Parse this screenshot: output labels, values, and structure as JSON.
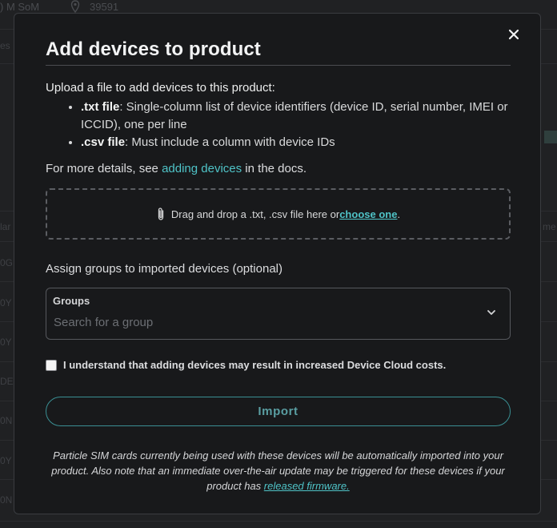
{
  "background": {
    "top_text_1": ") M SoM",
    "top_text_2": "39591",
    "side_fragments": [
      "es",
      "lar",
      "0G",
      "0Y",
      "0Y",
      "DEL",
      "0N",
      "0Y",
      "0N",
      "me"
    ]
  },
  "modal": {
    "title": "Add devices to product",
    "close_icon": "close-icon",
    "intro": "Upload a file to add devices to this product:",
    "bullets": [
      {
        "label": ".txt file",
        "text": ": Single-column list of device identifiers (device ID, serial number, IMEI or ICCID), one per line"
      },
      {
        "label": ".csv file",
        "text": ": Must include a column with device IDs"
      }
    ],
    "more_prefix": "For more details, see ",
    "more_link": "adding devices",
    "more_suffix": " in the docs.",
    "dropzone": {
      "icon": "paperclip-icon",
      "text": "Drag and drop a .txt, .csv file here or ",
      "choose_link": "choose one",
      "suffix": "."
    },
    "assign_label": "Assign groups to imported devices (optional)",
    "groups": {
      "label": "Groups",
      "placeholder": "Search for a group",
      "value": ""
    },
    "agree_text": "I understand that adding devices may result in increased Device Cloud costs.",
    "agree_checked": false,
    "import_label": "Import",
    "note_text": "Particle SIM cards currently being used with these devices will be automatically imported into your product. Also note that an immediate over-the-air update may be triggered for these devices if your product has ",
    "note_link": "released firmware."
  },
  "colors": {
    "accent": "#4fc3c7",
    "background": "#1d1e20",
    "modal": "#18191b"
  }
}
